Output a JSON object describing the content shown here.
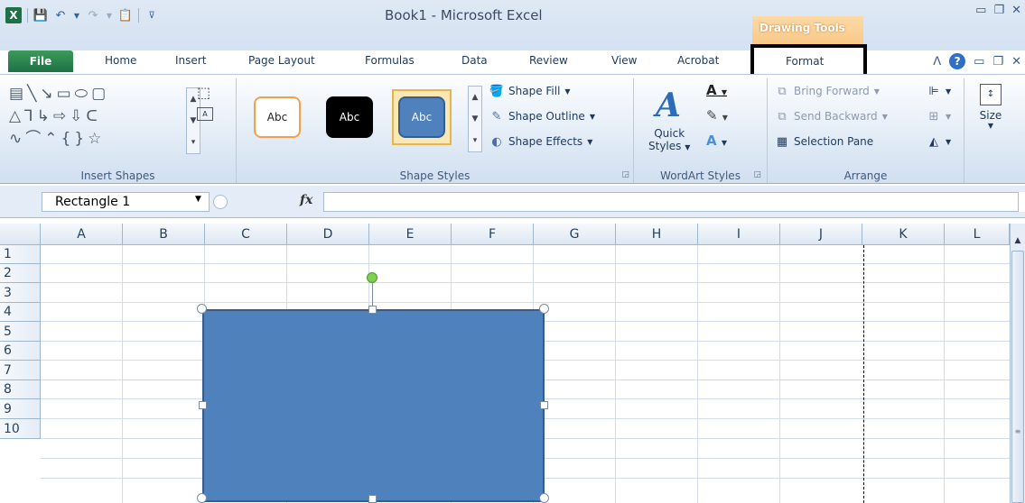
{
  "title_bar": {
    "window_title": "Book1  -  Microsoft Excel",
    "contextual_tab_group": "Drawing Tools"
  },
  "tabs": [
    {
      "label": "File"
    },
    {
      "label": "Home"
    },
    {
      "label": "Insert"
    },
    {
      "label": "Page Layout"
    },
    {
      "label": "Formulas"
    },
    {
      "label": "Data"
    },
    {
      "label": "Review"
    },
    {
      "label": "View"
    },
    {
      "label": "Acrobat"
    },
    {
      "label": "Format"
    }
  ],
  "ribbon": {
    "insert_shapes": {
      "label": "Insert Shapes"
    },
    "shape_styles": {
      "label": "Shape Styles",
      "swatches": [
        "Abc",
        "Abc",
        "Abc"
      ],
      "shape_fill": "Shape Fill",
      "shape_outline": "Shape Outline",
      "shape_effects": "Shape Effects"
    },
    "wordart_styles": {
      "label": "WordArt Styles",
      "quick_styles_line1": "Quick",
      "quick_styles_line2": "Styles"
    },
    "arrange": {
      "label": "Arrange",
      "bring_forward": "Bring Forward",
      "send_backward": "Send Backward",
      "selection_pane": "Selection Pane"
    },
    "size": {
      "label": "Size"
    }
  },
  "formula_bar": {
    "name_box": "Rectangle 1",
    "fx": "fx",
    "formula": ""
  },
  "sheet": {
    "columns": [
      "A",
      "B",
      "C",
      "D",
      "E",
      "F",
      "G",
      "H",
      "I",
      "J",
      "K",
      "L"
    ],
    "rows": [
      "1",
      "2",
      "3",
      "4",
      "5",
      "6",
      "7",
      "8",
      "9",
      "10"
    ]
  },
  "colors": {
    "shape_fill": "#4f81bd",
    "shape_border": "#385d8a",
    "file_tab": "#1e7145",
    "drawing_tools": "#f8c580"
  }
}
